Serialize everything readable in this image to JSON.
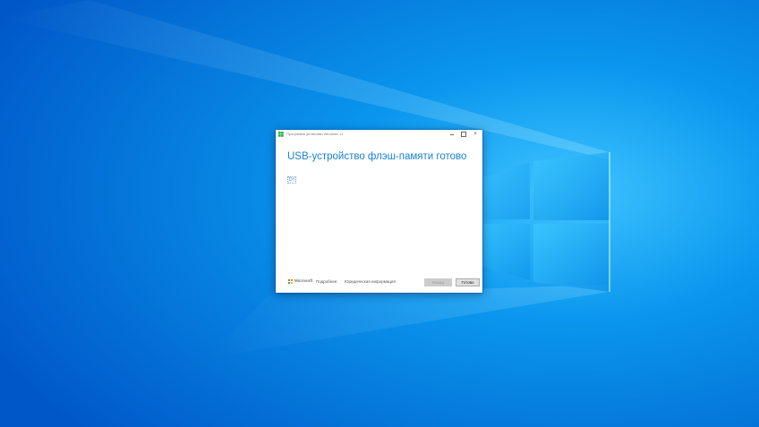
{
  "window": {
    "title": "Программа установки Windows 11",
    "controls": {
      "minimize": "minimize-icon",
      "maximize": "maximize-icon",
      "close": "×"
    }
  },
  "main": {
    "heading": "USB-устройство флэш-памяти готово",
    "drive_label": "D:\\"
  },
  "footer": {
    "brand": "Microsoft",
    "links": [
      "Подробнее",
      "Юридическая информация"
    ],
    "back_label": "Назад",
    "finish_label": "Готово"
  },
  "colors": {
    "accent": "#1a82d6",
    "desktop": "#0a7fe0"
  }
}
